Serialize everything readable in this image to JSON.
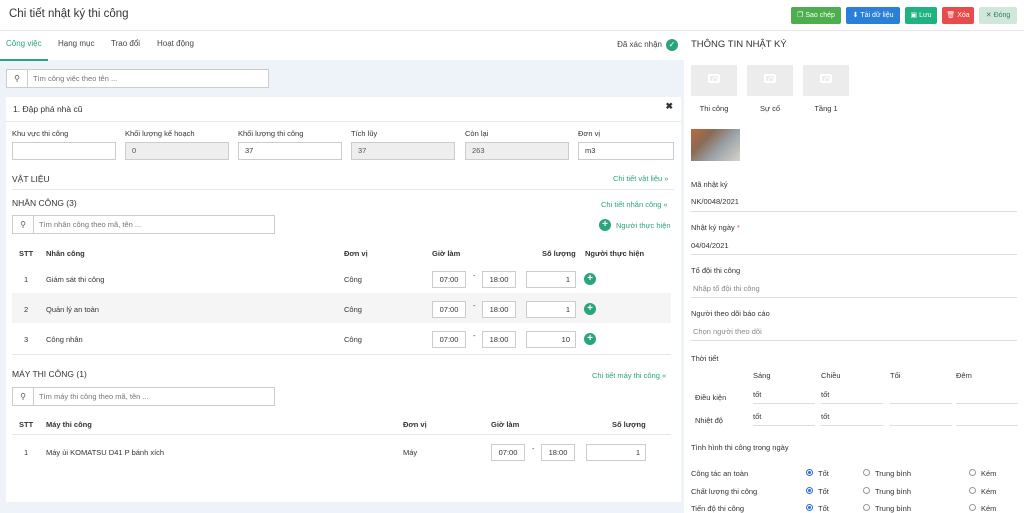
{
  "header": {
    "title": "Chi tiết nhật ký thi công",
    "buttons": [
      {
        "label": "Sao chép",
        "icon": "copy-icon",
        "color": "#4cae4c"
      },
      {
        "label": "Tải dữ liệu",
        "icon": "download-icon",
        "color": "#2a7fd6"
      },
      {
        "label": "Lưu",
        "icon": "save-icon",
        "color": "#1fb37f"
      },
      {
        "label": "Xóa",
        "icon": "trash-icon",
        "color": "#e94b4b"
      },
      {
        "label": "Đóng",
        "icon": "close-icon",
        "color": "#cfe8db"
      }
    ]
  },
  "tabs": [
    "Công việc",
    "Hạng mục",
    "Trao đổi",
    "Hoạt động"
  ],
  "status": {
    "label": "Đã xác nhận"
  },
  "search": {
    "placeholder": "Tìm công việc theo tên ..."
  },
  "task": {
    "title": "1. Đập phá nhà cũ",
    "fields": [
      {
        "label": "Khu vực thi công",
        "value": "",
        "readonly": false
      },
      {
        "label": "Khối lượng kế hoạch",
        "value": "0",
        "readonly": true
      },
      {
        "label": "Khối lượng thi công",
        "value": "37",
        "readonly": false
      },
      {
        "label": "Tích lũy",
        "value": "37",
        "readonly": true
      },
      {
        "label": "Còn lại",
        "value": "263",
        "readonly": true
      },
      {
        "label": "Đơn vị",
        "value": "m3",
        "readonly": false
      }
    ]
  },
  "materials": {
    "title": "VẬT LIỆU",
    "link": "Chi tiết vật liệu »"
  },
  "labor": {
    "title": "NHÂN CÔNG (3)",
    "link": "Chi tiết nhân công «",
    "search_placeholder": "Tìm nhân công theo mã, tên ...",
    "add_performer": "Người thực hiện",
    "columns": [
      "STT",
      "Nhân công",
      "Đơn vị",
      "Giờ làm",
      "Số lượng",
      "Người thực hiện"
    ],
    "rows": [
      {
        "stt": "1",
        "name": "Giám sát thi công",
        "unit": "Công",
        "start": "07:00",
        "end": "18:00",
        "qty": "1"
      },
      {
        "stt": "2",
        "name": "Quản lý an toàn",
        "unit": "Công",
        "start": "07:00",
        "end": "18:00",
        "qty": "1"
      },
      {
        "stt": "3",
        "name": "Công nhân",
        "unit": "Công",
        "start": "07:00",
        "end": "18:00",
        "qty": "10"
      }
    ]
  },
  "machines": {
    "title": "MÁY THI CÔNG (1)",
    "link": "Chi tiết máy thi công «",
    "search_placeholder": "Tìm máy thi công theo mã, tên ...",
    "columns": [
      "STT",
      "Máy thi công",
      "Đơn vị",
      "Giờ làm",
      "Số lượng"
    ],
    "rows": [
      {
        "stt": "1",
        "name": "Máy ủi KOMATSU D41 P bánh xích",
        "unit": "Máy",
        "start": "07:00",
        "end": "18:00",
        "qty": "1"
      }
    ]
  },
  "info": {
    "title": "THÔNG TIN NHẬT KÝ",
    "photos": [
      "Thi công",
      "Sự cố",
      "Tầng 1"
    ],
    "code_label": "Mã nhật ký",
    "code_value": "NK/0048/2021",
    "date_label": "Nhật ký ngày",
    "date_value": "04/04/2021",
    "team_label": "Tổ đội thi công",
    "team_placeholder": "Nhập tổ đội thi công",
    "follower_label": "Người theo dõi báo cáo",
    "follower_placeholder": "Chọn người theo dõi",
    "weather_label": "Thời tiết",
    "weather_cols": [
      "Sáng",
      "Chiều",
      "Tối",
      "Đêm"
    ],
    "weather_rows": [
      {
        "label": "Điều kiện",
        "values": [
          "tốt",
          "tốt",
          "",
          ""
        ]
      },
      {
        "label": "Nhiệt độ",
        "values": [
          "tốt",
          "tốt",
          "",
          ""
        ]
      }
    ],
    "status_label": "Tình hình thi công trong ngày",
    "status_rows": [
      {
        "label": "Công tác an toàn",
        "selected": "Tốt"
      },
      {
        "label": "Chất lượng thi công",
        "selected": "Tốt"
      },
      {
        "label": "Tiến độ thi công",
        "selected": "Tốt"
      }
    ],
    "options": [
      "Tốt",
      "Trung bình",
      "Kém"
    ]
  }
}
